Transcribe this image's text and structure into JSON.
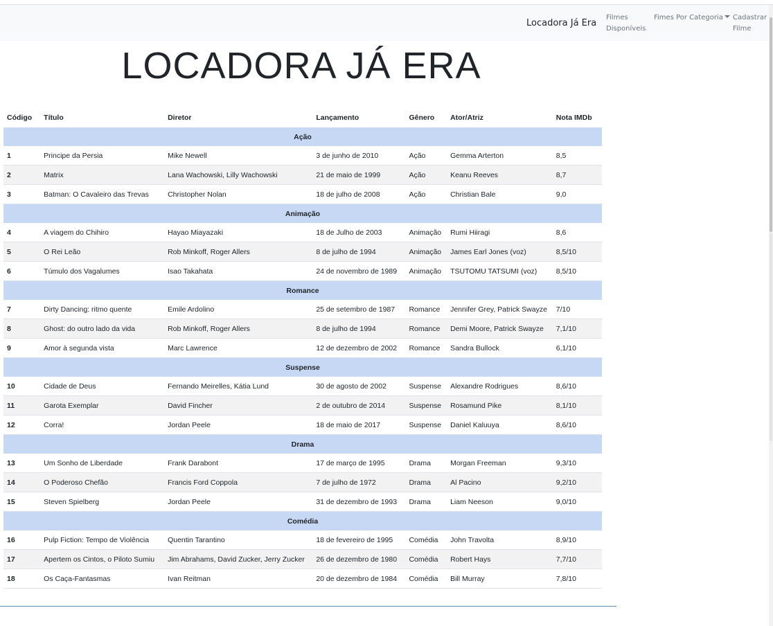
{
  "nav": {
    "brand": "Locadora Já Era",
    "links": [
      {
        "label_line1": "Filmes",
        "label_line2": "Disponíveis"
      },
      {
        "label": "Fimes Por Categoria"
      },
      {
        "label_line1": "Cadastrar",
        "label_line2": "Filme"
      }
    ]
  },
  "page_title": "LOCADORA JÁ ERA",
  "table": {
    "headers": [
      "Código",
      "Título",
      "Diretor",
      "Lançamento",
      "Gênero",
      "Ator/Atriz",
      "Nota IMDb"
    ],
    "categories": [
      {
        "name": "Ação",
        "rows": [
          [
            "1",
            "Principe da Persia",
            "Mike Newell",
            "3 de junho de 2010",
            "Ação",
            "Gemma Arterton",
            "8,5"
          ],
          [
            "2",
            "Matrix",
            "Lana Wachowski, Lilly Wachowski",
            "21 de maio de 1999",
            "Ação",
            "Keanu Reeves",
            "8,7"
          ],
          [
            "3",
            "Batman: O Cavaleiro das Trevas",
            "Christopher Nolan",
            "18 de julho de 2008",
            "Ação",
            "Christian Bale",
            "9,0"
          ]
        ]
      },
      {
        "name": "Animação",
        "rows": [
          [
            "4",
            "A viagem do Chihiro",
            "Hayao Miayazaki",
            "18 de Julho de 2003",
            "Animação",
            "Rumi Hiiragi",
            "8,6"
          ],
          [
            "5",
            "O Rei Leão",
            "Rob Minkoff, Roger Allers",
            "8 de julho de 1994",
            "Animação",
            "James Earl Jones (voz)",
            "8,5/10"
          ],
          [
            "6",
            "Túmulo dos Vagalumes",
            "Isao Takahata",
            "24 de novembro de 1989",
            "Animação",
            "TSUTOMU TATSUMI (voz)",
            "8,5/10"
          ]
        ]
      },
      {
        "name": "Romance",
        "rows": [
          [
            "7",
            "Dirty Dancing: ritmo quente",
            "Emile Ardolino",
            "25 de setembro de 1987",
            "Romance",
            "Jennifer Grey, Patrick Swayze",
            "7/10"
          ],
          [
            "8",
            "Ghost: do outro lado da vida",
            "Rob Minkoff, Roger Allers",
            "8 de julho de 1994",
            "Romance",
            "Demi Moore, Patrick Swayze",
            "7,1/10"
          ],
          [
            "9",
            "Amor à segunda vista",
            "Marc Lawrence",
            "12 de dezembro de 2002",
            "Romance",
            "Sandra Bullock",
            "6,1/10"
          ]
        ]
      },
      {
        "name": "Suspense",
        "rows": [
          [
            "10",
            "Cidade de Deus",
            "Fernando Meirelles, Kátia Lund",
            "30 de agosto de 2002",
            "Suspense",
            "Alexandre Rodrigues",
            "8,6/10"
          ],
          [
            "11",
            "Garota Exemplar",
            "David Fincher",
            "2 de outubro de 2014",
            "Suspense",
            "Rosamund Pike",
            "8,1/10"
          ],
          [
            "12",
            "Corra!",
            "Jordan Peele",
            "18 de maio de 2017",
            "Suspense",
            "Daniel Kaluuya",
            "8,6/10"
          ]
        ]
      },
      {
        "name": "Drama",
        "rows": [
          [
            "13",
            "Um Sonho de Liberdade",
            "Frank Darabont",
            "17 de março de 1995",
            "Drama",
            "Morgan Freeman",
            "9,3/10"
          ],
          [
            "14",
            "O Poderoso Chefão",
            "Francis Ford Coppola",
            "7 de julho de 1972",
            "Drama",
            "Al Pacino",
            "9,2/10"
          ],
          [
            "15",
            "Steven Spielberg",
            "Jordan Peele",
            "31 de dezembro de 1993",
            "Drama",
            "Liam Neeson",
            "9,0/10"
          ]
        ]
      },
      {
        "name": "Comédia",
        "rows": [
          [
            "16",
            "Pulp Fiction: Tempo de Violência",
            "Quentin Tarantino",
            "18 de fevereiro de 1995",
            "Comédia",
            "John Travolta",
            "8,9/10"
          ],
          [
            "17",
            "Apertem os Cintos, o Piloto Sumiu",
            "Jim Abrahams, David Zucker, Jerry Zucker",
            "26 de dezembro de 1980",
            "Comédia",
            "Robert Hays",
            "7,7/10"
          ],
          [
            "18",
            "Os Caça-Fantasmas",
            "Ivan Reitman",
            "20 de dezembro de 1984",
            "Comédia",
            "Bill Murray",
            "7,8/10"
          ]
        ]
      }
    ]
  }
}
